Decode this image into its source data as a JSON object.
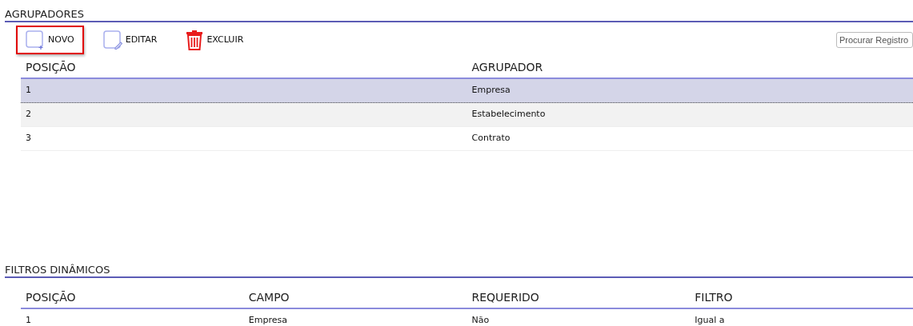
{
  "sections": [
    {
      "title": "AGRUPADORES",
      "toolbar": [
        {
          "kind": "new",
          "label": "NOVO",
          "highlighted": true
        },
        {
          "kind": "edit",
          "label": "EDITAR",
          "highlighted": false
        },
        {
          "kind": "delete",
          "label": "EXCLUIR",
          "highlighted": false
        }
      ],
      "search": {
        "placeholder": "Procurar Registro"
      },
      "columns": [
        "POSIÇÃO",
        "",
        "AGRUPADOR",
        ""
      ],
      "rows": [
        {
          "cells": [
            "1",
            "",
            "Empresa",
            ""
          ],
          "selected": true
        },
        {
          "cells": [
            "2",
            "",
            "Estabelecimento",
            ""
          ],
          "selected": false
        },
        {
          "cells": [
            "3",
            "",
            "Contrato",
            ""
          ],
          "selected": false
        }
      ]
    },
    {
      "title": "FILTROS DINÂMICOS",
      "columns": [
        "POSIÇÃO",
        "CAMPO",
        "REQUERIDO",
        "FILTRO"
      ],
      "rows": [
        {
          "cells": [
            "1",
            "Empresa",
            "Não",
            "Igual a"
          ],
          "selected": false
        }
      ]
    }
  ]
}
